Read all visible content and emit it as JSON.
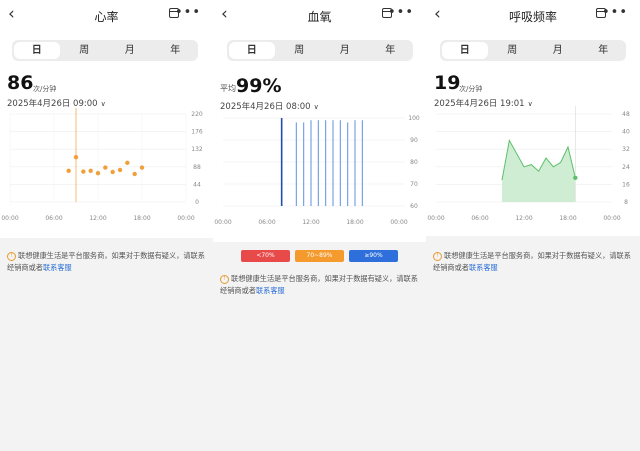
{
  "panels": {
    "heart": {
      "title": "心率",
      "tabs": [
        "日",
        "周",
        "月",
        "年"
      ],
      "value": "86",
      "unit": "次/分钟",
      "date": "2025年4月26日  09:00",
      "y_ticks": [
        "220",
        "176",
        "132",
        "88",
        "44",
        "0"
      ],
      "x_ticks": [
        "00:00",
        "06:00",
        "12:00",
        "18:00",
        "00:00"
      ]
    },
    "spo2": {
      "title": "血氧",
      "tabs": [
        "日",
        "周",
        "月",
        "年"
      ],
      "prefix": "平均",
      "value": "99%",
      "date": "2025年4月26日  08:00",
      "y_ticks": [
        "100",
        "90",
        "80",
        "70",
        "60"
      ],
      "x_ticks": [
        "00:00",
        "06:00",
        "12:00",
        "18:00",
        "00:00"
      ],
      "legend": [
        "<70%",
        "70~89%",
        "≥90%"
      ]
    },
    "resp": {
      "title": "呼吸频率",
      "tabs": [
        "日",
        "周",
        "月",
        "年"
      ],
      "value": "19",
      "unit": "次/分钟",
      "date": "2025年4月26日  19:01",
      "y_ticks": [
        "48",
        "40",
        "32",
        "24",
        "16",
        "8"
      ],
      "x_ticks": [
        "00:00",
        "06:00",
        "12:00",
        "18:00",
        "00:00"
      ]
    }
  },
  "notice": {
    "text": "联想健康生活是平台服务商，如果对于数据有疑义，请联系经销商或者",
    "link": "联系客服"
  },
  "colors": {
    "heart": "#f0a03a",
    "spo2": "#2f6fdb",
    "resp": "#5cc06a",
    "low": "#e84a4a",
    "mid": "#f59a2d",
    "high": "#2f6fdb"
  },
  "chart_data": [
    {
      "type": "scatter",
      "series": [
        {
          "x": [
            "08:00",
            "09:00",
            "10:00",
            "11:00",
            "12:00",
            "13:00",
            "14:00",
            "15:00",
            "16:00",
            "17:00",
            "18:00"
          ],
          "values": [
            78,
            112,
            76,
            78,
            72,
            86,
            75,
            80,
            98,
            70,
            86
          ]
        }
      ],
      "ylim": [
        0,
        220
      ],
      "xlim": [
        "00:00",
        "24:00"
      ],
      "highlight": "09:00"
    },
    {
      "type": "bar",
      "series": [
        {
          "x": [
            "08:00",
            "10:00",
            "11:00",
            "12:00",
            "13:00",
            "14:00",
            "15:00",
            "16:00",
            "17:00",
            "18:00",
            "19:00"
          ],
          "values": [
            100,
            98,
            98,
            99,
            99,
            99,
            99,
            99,
            98,
            99,
            99
          ]
        }
      ],
      "ylim": [
        60,
        100
      ],
      "xlim": [
        "00:00",
        "24:00"
      ],
      "highlight": "08:00"
    },
    {
      "type": "area",
      "series": [
        {
          "x": [
            "09:00",
            "10:00",
            "12:00",
            "13:00",
            "14:00",
            "15:00",
            "16:00",
            "17:00",
            "18:00",
            "19:00"
          ],
          "values": [
            18,
            36,
            24,
            25,
            22,
            28,
            24,
            26,
            33,
            19
          ]
        }
      ],
      "ylim": [
        8,
        48
      ],
      "xlim": [
        "00:00",
        "24:00"
      ],
      "highlight": "19:00"
    }
  ]
}
